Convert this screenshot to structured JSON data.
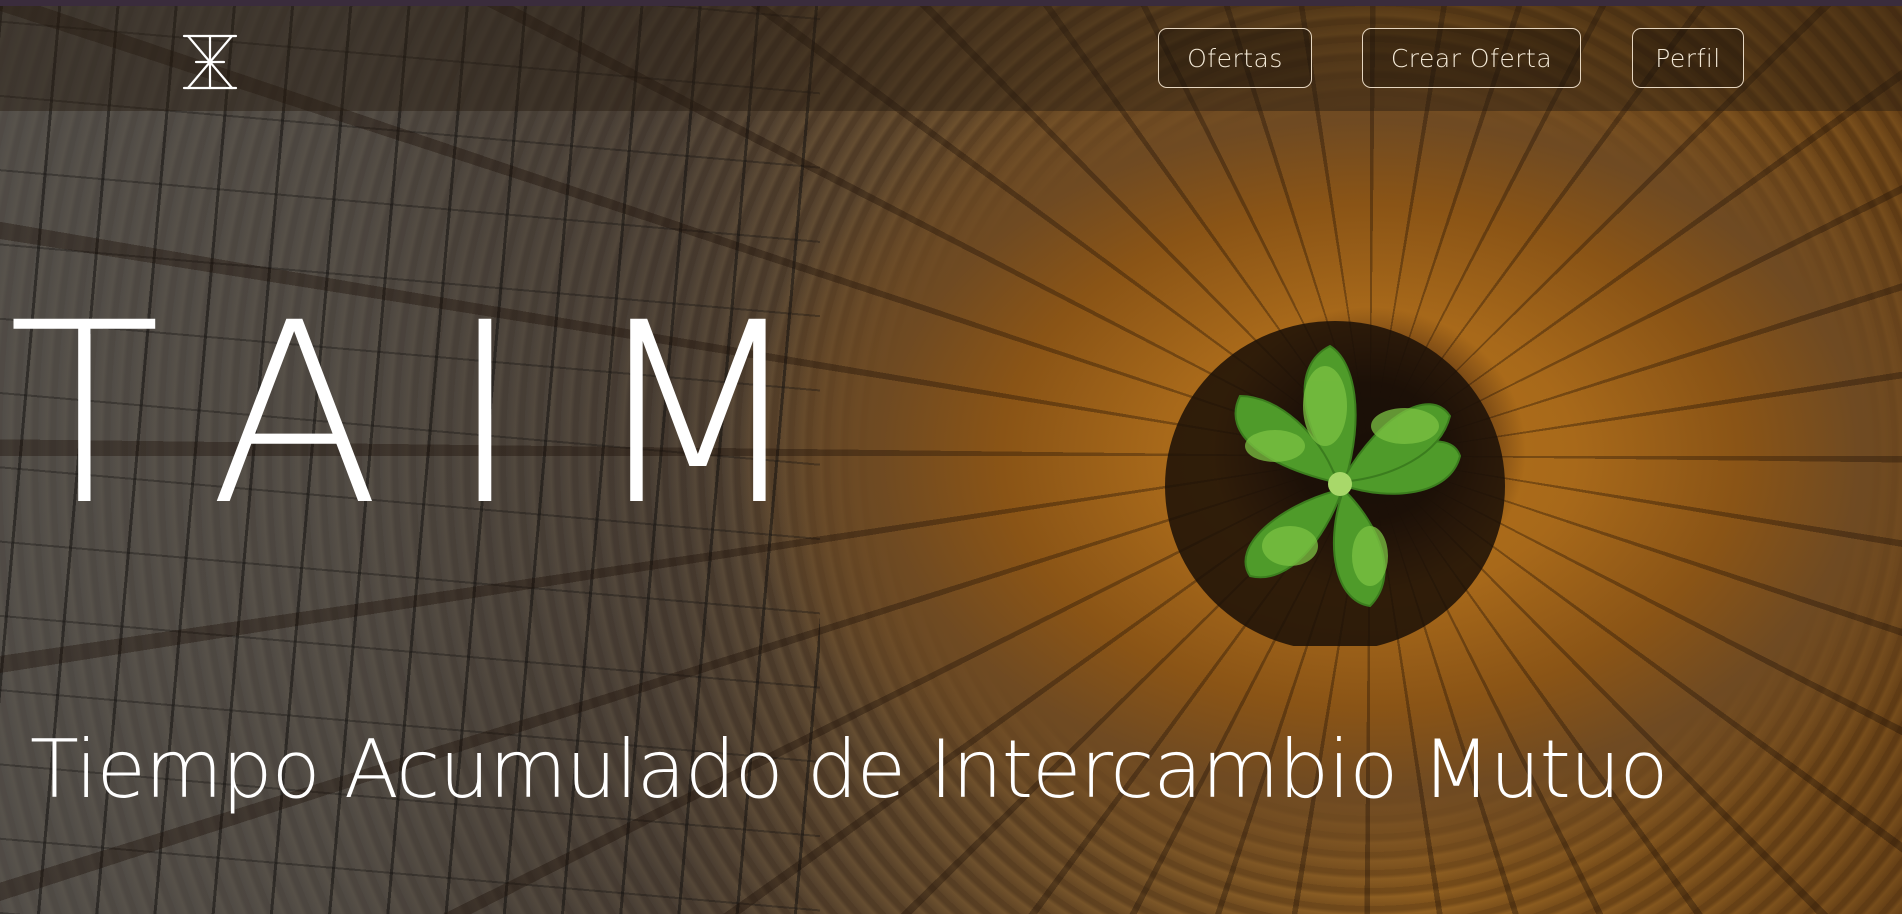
{
  "logo": {
    "icon": "taim-hourglass-logo"
  },
  "nav": {
    "items": [
      {
        "label": "Ofertas"
      },
      {
        "label": "Crear Oferta"
      },
      {
        "label": "Perfil"
      }
    ]
  },
  "hero": {
    "title": "TAIM",
    "subtitle": "Tiempo Acumulado de Intercambio Mutuo",
    "image": "tree-stump-sprout"
  },
  "colors": {
    "nav_border": "#e6d6c0",
    "text": "#ffffff",
    "top_line": "#3a2c3c",
    "wood_orange": "#b37118",
    "leaf_green": "#5fb032"
  }
}
